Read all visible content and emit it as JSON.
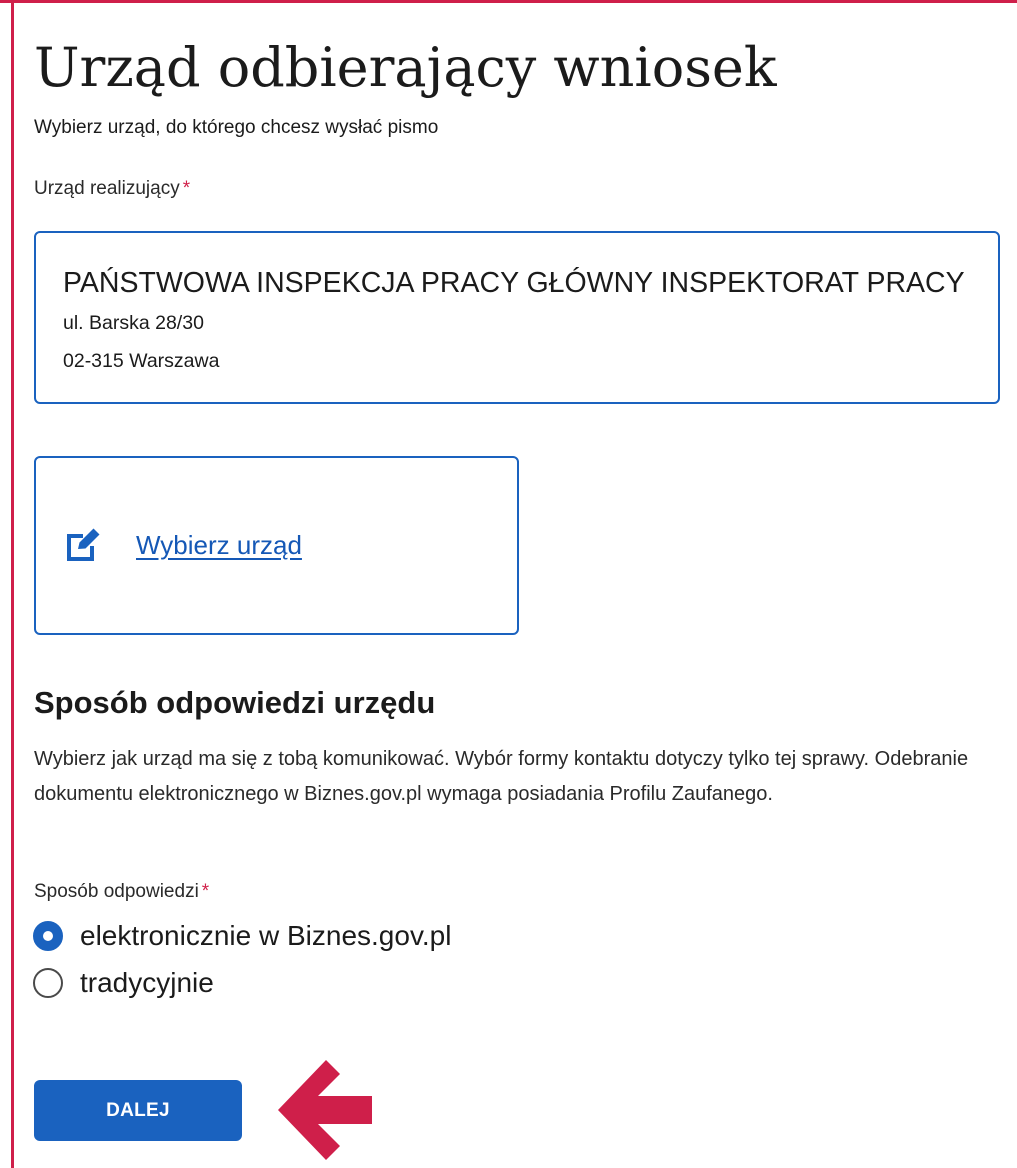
{
  "page": {
    "title": "Urząd odbierający wniosek",
    "subtitle": "Wybierz urząd, do którego chcesz wysłać pismo"
  },
  "office_field": {
    "label": "Urząd realizujący",
    "required_mark": "*",
    "selected_office": {
      "name": "PAŃSTWOWA INSPEKCJA PRACY GŁÓWNY INSPEKTORAT PRACY",
      "street": "ul. Barska 28/30",
      "city": "02-315 Warszawa"
    },
    "choose_link": "Wybierz urząd",
    "choose_icon": "edit-icon"
  },
  "response_section": {
    "heading": "Sposób odpowiedzi urzędu",
    "description": "Wybierz jak urząd ma się z tobą komunikować. Wybór formy kontaktu dotyczy tylko tej sprawy. Odebranie dokumentu elektronicznego w Biznes.gov.pl wymaga posiadania Profilu Zaufanego.",
    "field_label": "Sposób odpowiedzi",
    "required_mark": "*",
    "options": [
      {
        "label": "elektronicznie w Biznes.gov.pl",
        "selected": true
      },
      {
        "label": "tradycyjnie",
        "selected": false
      }
    ]
  },
  "actions": {
    "next_label": "DALEJ"
  },
  "annotation": {
    "arrow_icon": "arrow-left-icon",
    "arrow_color": "#cf1f4a"
  },
  "colors": {
    "primary": "#1a62bf",
    "link": "#1558b6",
    "required": "#d1214a",
    "frame": "#cf1f4a"
  }
}
